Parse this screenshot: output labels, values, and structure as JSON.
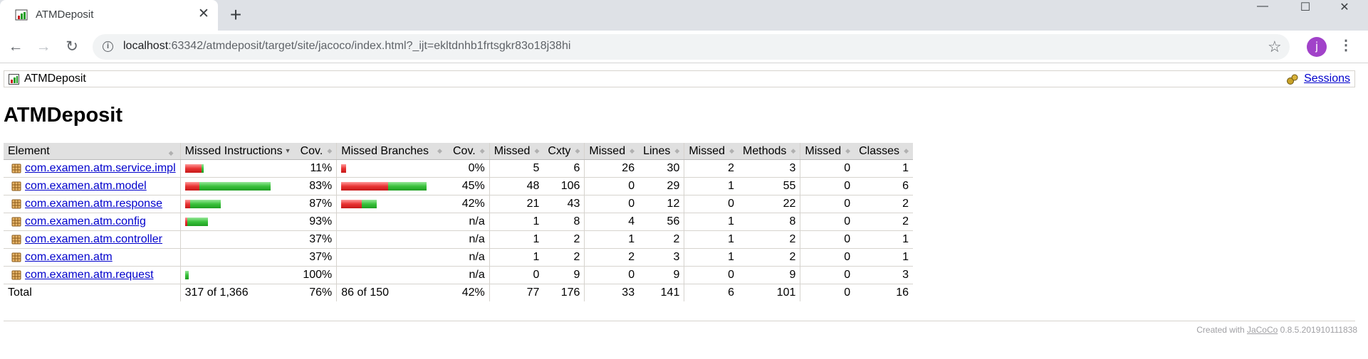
{
  "browser": {
    "tab_title": "ATMDeposit",
    "new_tab_label": "+",
    "close_tab_label": "✕",
    "url_host": "localhost",
    "url_path": ":63342/atmdeposit/target/site/jacoco/index.html?_ijt=ekltdnhb1frtsgkr83o18j38hi",
    "avatar_letter": "j",
    "minimize": "—",
    "maximize": "☐",
    "close_window": "✕"
  },
  "breadcrumb": {
    "label": "ATMDeposit",
    "sessions_label": "Sessions"
  },
  "page_title": "ATMDeposit",
  "table": {
    "headers": [
      "Element",
      "Missed Instructions",
      "Cov.",
      "Missed Branches",
      "Cov.",
      "Missed",
      "Cxty",
      "Missed",
      "Lines",
      "Missed",
      "Methods",
      "Missed",
      "Classes"
    ],
    "rows": [
      {
        "name": "com.examen.atm.service.impl",
        "instr_missed": 0.89,
        "instr_covered": 0.11,
        "instr_cov": "11%",
        "branch_missed": 1.0,
        "branch_covered": 0.0,
        "branch_cov": "0%",
        "cxty_missed": "5",
        "cxty": "6",
        "lines_missed": "26",
        "lines": "30",
        "methods_missed": "2",
        "methods": "3",
        "classes_missed": "0",
        "classes": "1"
      },
      {
        "name": "com.examen.atm.model",
        "instr_missed": 0.17,
        "instr_covered": 0.83,
        "instr_cov": "83%",
        "branch_missed": 0.55,
        "branch_covered": 0.45,
        "branch_cov": "45%",
        "cxty_missed": "48",
        "cxty": "106",
        "lines_missed": "0",
        "lines": "29",
        "methods_missed": "1",
        "methods": "55",
        "classes_missed": "0",
        "classes": "6"
      },
      {
        "name": "com.examen.atm.response",
        "instr_missed": 0.13,
        "instr_covered": 0.87,
        "instr_cov": "87%",
        "branch_missed": 0.58,
        "branch_covered": 0.42,
        "branch_cov": "42%",
        "cxty_missed": "21",
        "cxty": "43",
        "lines_missed": "0",
        "lines": "12",
        "methods_missed": "0",
        "methods": "22",
        "classes_missed": "0",
        "classes": "2"
      },
      {
        "name": "com.examen.atm.config",
        "instr_missed": 0.07,
        "instr_covered": 0.93,
        "instr_cov": "93%",
        "branch_missed": null,
        "branch_covered": null,
        "branch_cov": "n/a",
        "cxty_missed": "1",
        "cxty": "8",
        "lines_missed": "4",
        "lines": "56",
        "methods_missed": "1",
        "methods": "8",
        "classes_missed": "0",
        "classes": "2"
      },
      {
        "name": "com.examen.atm.controller",
        "instr_missed": null,
        "instr_covered": null,
        "instr_cov": "37%",
        "branch_missed": null,
        "branch_covered": null,
        "branch_cov": "n/a",
        "cxty_missed": "1",
        "cxty": "2",
        "lines_missed": "1",
        "lines": "2",
        "methods_missed": "1",
        "methods": "2",
        "classes_missed": "0",
        "classes": "1"
      },
      {
        "name": "com.examen.atm",
        "instr_missed": null,
        "instr_covered": null,
        "instr_cov": "37%",
        "branch_missed": null,
        "branch_covered": null,
        "branch_cov": "n/a",
        "cxty_missed": "1",
        "cxty": "2",
        "lines_missed": "2",
        "lines": "3",
        "methods_missed": "1",
        "methods": "2",
        "classes_missed": "0",
        "classes": "1"
      },
      {
        "name": "com.examen.atm.request",
        "instr_missed": 0.0,
        "instr_covered": 1.0,
        "instr_cov": "100%",
        "branch_missed": null,
        "branch_covered": null,
        "branch_cov": "n/a",
        "cxty_missed": "0",
        "cxty": "9",
        "lines_missed": "0",
        "lines": "9",
        "methods_missed": "0",
        "methods": "9",
        "classes_missed": "0",
        "classes": "3"
      }
    ],
    "instr_bar_scale": [
      0.22,
      1.0,
      0.42,
      0.27,
      0,
      0,
      0.04
    ],
    "branch_bar_scale": [
      0.06,
      1.0,
      0.42,
      0,
      0,
      0,
      0
    ],
    "total": {
      "label": "Total",
      "instr": "317 of 1,366",
      "instr_cov": "76%",
      "branch": "86 of 150",
      "branch_cov": "42%",
      "cxty_missed": "77",
      "cxty": "176",
      "lines_missed": "33",
      "lines": "141",
      "methods_missed": "6",
      "methods": "101",
      "classes_missed": "0",
      "classes": "16"
    }
  },
  "footer": {
    "prefix": "Created with ",
    "link": "JaCoCo",
    "version": " 0.8.5.201910111838"
  },
  "colors": {
    "link": "#0000cc",
    "header_bg": "#e0e0e0",
    "bar_red": "#e93333",
    "bar_green": "#39c13b"
  }
}
